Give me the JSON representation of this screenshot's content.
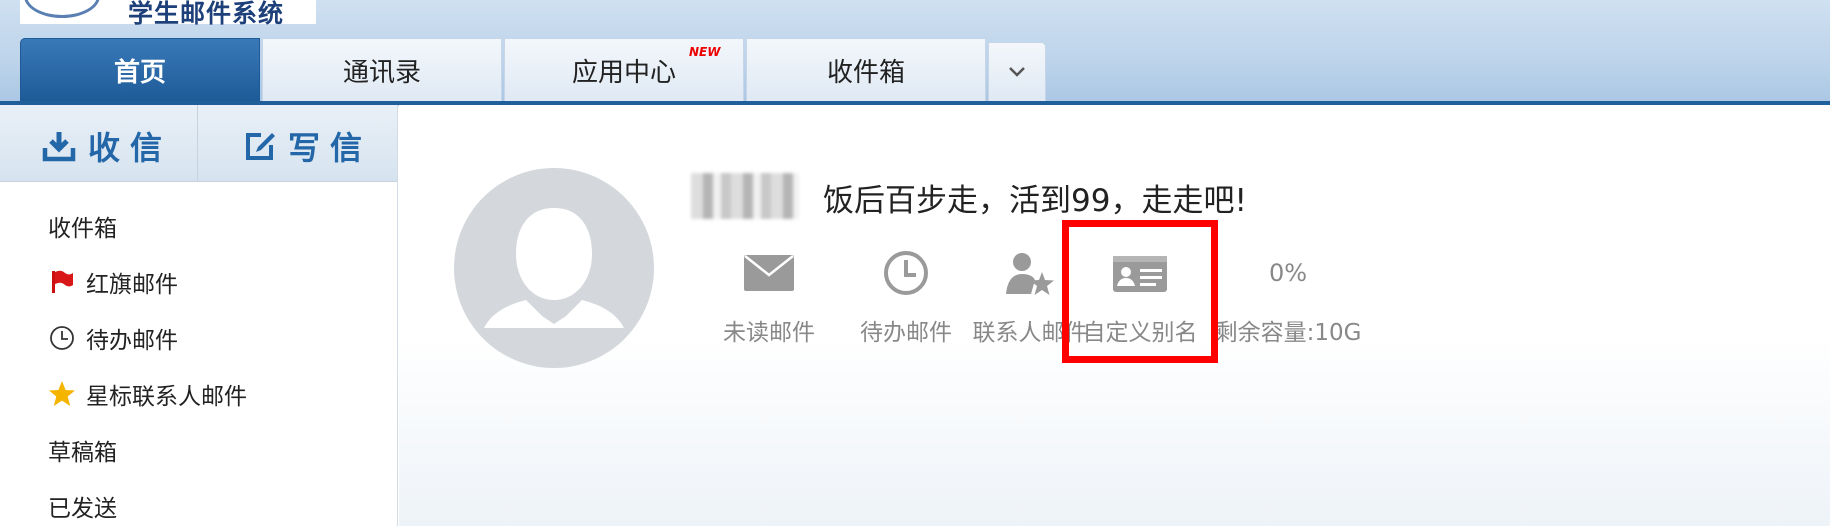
{
  "header": {
    "logo_text": "学生邮件系统",
    "tabs": [
      {
        "label": "首页",
        "active": true
      },
      {
        "label": "通讯录",
        "active": false
      },
      {
        "label": "应用中心",
        "badge": "NEW",
        "active": false
      },
      {
        "label": "收件箱",
        "active": false
      }
    ],
    "more_icon": "chevron-down-icon",
    "colors": {
      "accent": "#1f5f9a",
      "badge": "#ee0000"
    }
  },
  "sidebar": {
    "receive_label": "收信",
    "write_label": "写信",
    "folders": [
      {
        "label": "收件箱",
        "icon": null
      },
      {
        "label": "红旗邮件",
        "icon": "red-flag-icon"
      },
      {
        "label": "待办邮件",
        "icon": "clock-icon"
      },
      {
        "label": "星标联系人邮件",
        "icon": "star-icon"
      },
      {
        "label": "草稿箱",
        "icon": null
      },
      {
        "label": "已发送",
        "icon": null
      }
    ]
  },
  "main": {
    "greeting": "饭后百步走，活到99，走走吧!",
    "stats": [
      {
        "label": "未读邮件",
        "icon": "envelope-icon"
      },
      {
        "label": "待办邮件",
        "icon": "clock-icon"
      },
      {
        "label": "联系人邮件",
        "icon": "contact-star-icon"
      },
      {
        "label": "自定义别名",
        "icon": "id-card-icon"
      }
    ],
    "storage": {
      "percent": "0%",
      "label": "剩余容量:10G"
    },
    "highlight_color": "#ff0000"
  }
}
